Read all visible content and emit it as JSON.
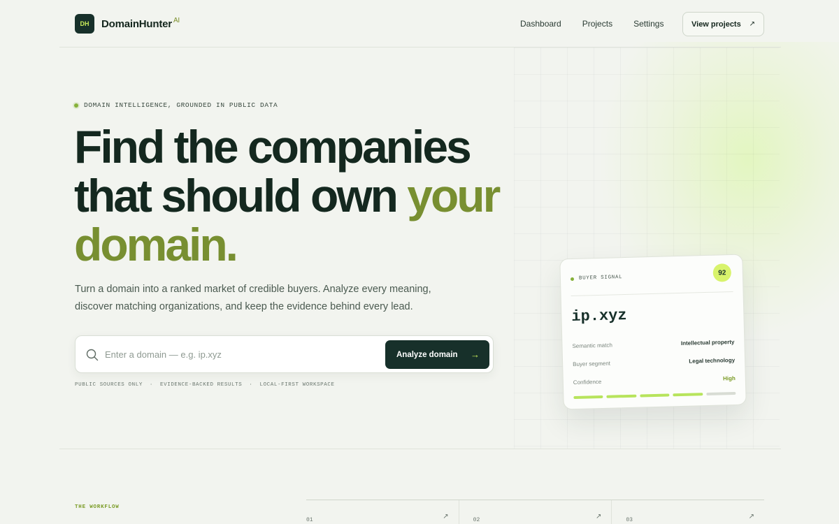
{
  "header": {
    "logo_mark": "DH",
    "brand": "DomainHunter",
    "brand_sup": "AI",
    "nav": [
      "Dashboard",
      "Projects",
      "Settings"
    ],
    "cta_label": "View projects",
    "cta_arrow": "↗"
  },
  "hero": {
    "eyebrow": "DOMAIN INTELLIGENCE, GROUNDED IN PUBLIC DATA",
    "headline_part1": "Find the companies that should own ",
    "headline_accent": "your domain.",
    "subtext": "Turn a domain into a ranked market of credible buyers. Analyze every meaning, discover matching organizations, and keep the evidence behind every lead.",
    "search_placeholder": "Enter a domain — e.g. ip.xyz",
    "search_value": "",
    "analyze_label": "Analyze domain",
    "analyze_arrow": "→",
    "tags": [
      "PUBLIC SOURCES ONLY",
      "EVIDENCE-BACKED RESULTS",
      "LOCAL-FIRST WORKSPACE"
    ],
    "tag_separator": "·"
  },
  "card": {
    "label": "BUYER SIGNAL",
    "score": "92",
    "domain": "ip.xyz",
    "rows": [
      {
        "key": "Semantic match",
        "value": "Intellectual property"
      },
      {
        "key": "Buyer segment",
        "value": "Legal technology"
      },
      {
        "key": "Confidence",
        "value": "High"
      }
    ],
    "confidence_level": 0.8
  },
  "workflow": {
    "label": "THE WORKFLOW",
    "steps": [
      {
        "number": "01",
        "arrow": "↗"
      },
      {
        "number": "02",
        "arrow": "↗"
      },
      {
        "number": "03",
        "arrow": "↗"
      }
    ]
  },
  "colors": {
    "brand_dark": "#17302a",
    "accent_olive": "#788f31",
    "accent_lime": "#c9ec5a",
    "background": "#f2f4ef"
  }
}
